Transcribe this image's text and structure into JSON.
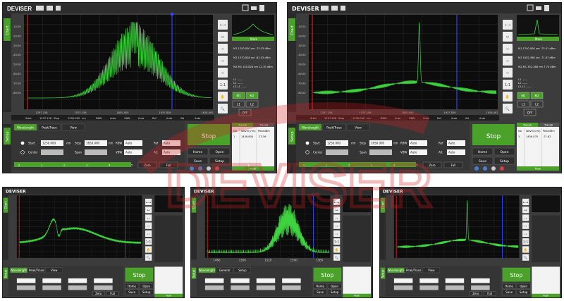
{
  "panels": [
    {
      "id": "p1",
      "logo": "DEVISER",
      "nav": {
        "chart": "Chart",
        "setup": "Setup"
      },
      "plot": {
        "y_ticks": [
          "-10.00",
          "-20.00",
          "-30.00",
          "-40.00",
          "-50.00",
          "-60.00",
          "-70.00",
          "-80.00"
        ],
        "x_ticks": [
          "1297.158",
          "1573.156",
          "1850.000",
          "1937.826",
          "1626.062"
        ],
        "status": [
          "Start",
          "1297.158",
          "Stop",
          "1250.000",
          "nm",
          "RBW",
          "Auto",
          "VBW",
          "Auto",
          "Ref",
          "Auto",
          "Att",
          "Auto"
        ],
        "trace_color": "#3fd43f",
        "shape": "comb"
      },
      "side": {
        "thumb_label": "Mark",
        "markers": [
          "M1  1250.000 nm -75.33 dBm",
          "M2  1570.828 nm -82.03 dBm",
          "M2-M1 320.828 nm 12.70 dBm"
        ],
        "lines": [
          "L1 ------",
          "L2 ------",
          "L2-L1 ------"
        ],
        "buttons": [
          "M1",
          "M2",
          "L1",
          "L2",
          "OFF"
        ],
        "rail": [
          "←→",
          "↔",
          "‹›",
          "‹›",
          "‹›",
          "1:1",
          "✋",
          "🔍"
        ]
      },
      "setup": {
        "tabs": [
          "Wavelength",
          "Peak/Trace",
          "View"
        ],
        "start_label": "Start",
        "start_value": "1250.000",
        "center_label": "Center",
        "stop_label": "Stop",
        "stop_value": "1650.000",
        "span_label": "Span",
        "unit": "nm",
        "rbw_label": "RBW",
        "vbw_label": "VBW",
        "ref_label": "Ref",
        "att_label": "Att",
        "auto": "Auto",
        "slider_labels": [
          "0",
          "1",
          "2",
          "3",
          "4",
          "5"
        ],
        "zero": "Zero",
        "full": "Full",
        "stop_button": "Stop",
        "home": "Home",
        "open": "Open",
        "save": "Save",
        "setup_btn": "Setup",
        "trace_tabs": [
          "TraceA",
          "TraceB"
        ],
        "table_head": [
          "No",
          "Wavel.(nm)",
          "PeakdBm"
        ],
        "table_row": [
          "1",
          "1456.804",
          "-73.56"
        ],
        "peak_footer": "Peak"
      }
    },
    {
      "id": "p2",
      "logo": "DEVISER",
      "nav": {
        "chart": "Chart",
        "setup": "Setup"
      },
      "plot": {
        "y_ticks": [
          "-10.00",
          "-20.00",
          "-30.00",
          "-40.00",
          "-50.00",
          "-60.00",
          "-70.00",
          "-80.00"
        ],
        "x_ticks": [
          "1297.158",
          "1573.156",
          "1850.000",
          "1937.826",
          "1626.062"
        ],
        "status": [
          "Start",
          "1297.158",
          "Stop",
          "1250.000",
          "nm",
          "RBW",
          "Auto",
          "VBW",
          "Auto",
          "Ref",
          "Auto",
          "Att",
          "Auto"
        ],
        "trace_color": "#3fd43f",
        "shape": "spike"
      },
      "side": {
        "thumb_label": "Mark",
        "markers": [
          "M1  1250.000 nm -75.41 dBm",
          "M2  1602.368 nm -71.67 dBm",
          "M2-M1 352.368 nm 7.74 dBm"
        ],
        "lines": [
          "L1 ------",
          "L2 ------",
          "L2-L1 ------"
        ],
        "buttons": [
          "M1",
          "M2",
          "L1",
          "L2",
          "OFF"
        ],
        "rail": [
          "←→",
          "↔",
          "‹›",
          "‹›",
          "‹›",
          "1:1",
          "✋",
          "🔍"
        ]
      },
      "setup": {
        "tabs": [
          "Wavelength",
          "Peak/Trace",
          "View"
        ],
        "start_label": "Start",
        "start_value": "1250.000",
        "center_label": "Center",
        "stop_label": "Stop",
        "stop_value": "1650.000",
        "span_label": "Span",
        "unit": "nm",
        "rbw_label": "RBW",
        "vbw_label": "VBW",
        "ref_label": "Ref",
        "att_label": "Att",
        "auto": "Auto",
        "slider_labels": [
          "0",
          "1",
          "2",
          "3",
          "4",
          "5"
        ],
        "zero": "Zero",
        "full": "Full",
        "stop_button": "Stop",
        "home": "Home",
        "open": "Open",
        "save": "Save",
        "setup_btn": "Setup",
        "trace_tabs": [
          "TraceA",
          "TraceB"
        ],
        "table_head": [
          "No",
          "Wavel.(nm)",
          "PeakdBm"
        ],
        "table_row": [
          "1",
          "1456.070",
          "-71.62"
        ],
        "peak_footer": "Peak"
      }
    },
    {
      "id": "p3",
      "logo": "DEVISER",
      "nav": {
        "chart": "Chart",
        "setup": "Setup"
      },
      "plot": {
        "trace_color": "#3fd43f",
        "shape": "broad"
      },
      "side": {
        "rail": [
          "←→",
          "↔",
          "‹›",
          "‹›",
          "‹›",
          "1:1",
          "✋",
          "🔍"
        ]
      },
      "setup": {
        "tabs": [
          "Wavelength",
          "Peak/Trace",
          "View"
        ],
        "stop_button": "Stop",
        "home": "Home",
        "open": "Open",
        "save": "Save",
        "setup_btn": "Setup",
        "zero": "Zero",
        "full": "Full",
        "peak_footer": "Peak"
      }
    },
    {
      "id": "p4",
      "logo": "DEVISER",
      "nav": {
        "chart": "Chart",
        "setup": "Setup"
      },
      "plot": {
        "trace_color": "#3fd43f",
        "shape": "comb2",
        "x_ticks": [
          "1460",
          "1500",
          "1520",
          "1540",
          "1560"
        ]
      },
      "side": {
        "rail": [
          "←→",
          "↔",
          "‹›",
          "‹›",
          "‹›",
          "1:1",
          "✋",
          "🔍"
        ]
      },
      "setup": {
        "tabs": [
          "Wavelength",
          "General",
          "Setup"
        ],
        "stop_button": "Stop",
        "home": "Home",
        "open": "Open",
        "save": "Save",
        "setup_btn": "Setup",
        "peak_footer": "Peak"
      }
    },
    {
      "id": "p5",
      "logo": "DEVISER",
      "nav": {
        "chart": "Chart",
        "setup": "Setup"
      },
      "plot": {
        "trace_color": "#3fd43f",
        "shape": "spike"
      },
      "side": {
        "rail": [
          "←→",
          "↔",
          "‹›",
          "‹›",
          "‹›",
          "1:1",
          "✋",
          "🔍"
        ]
      },
      "setup": {
        "tabs": [
          "Wavelength",
          "Peak/Trace",
          "View"
        ],
        "stop_button": "Stop",
        "home": "Home",
        "open": "Open",
        "save": "Save",
        "setup_btn": "Setup",
        "zero": "Zero",
        "full": "Full",
        "peak_footer": "Peak"
      }
    }
  ],
  "watermark": {
    "text": "DEVISER",
    "color": "#d62020"
  }
}
